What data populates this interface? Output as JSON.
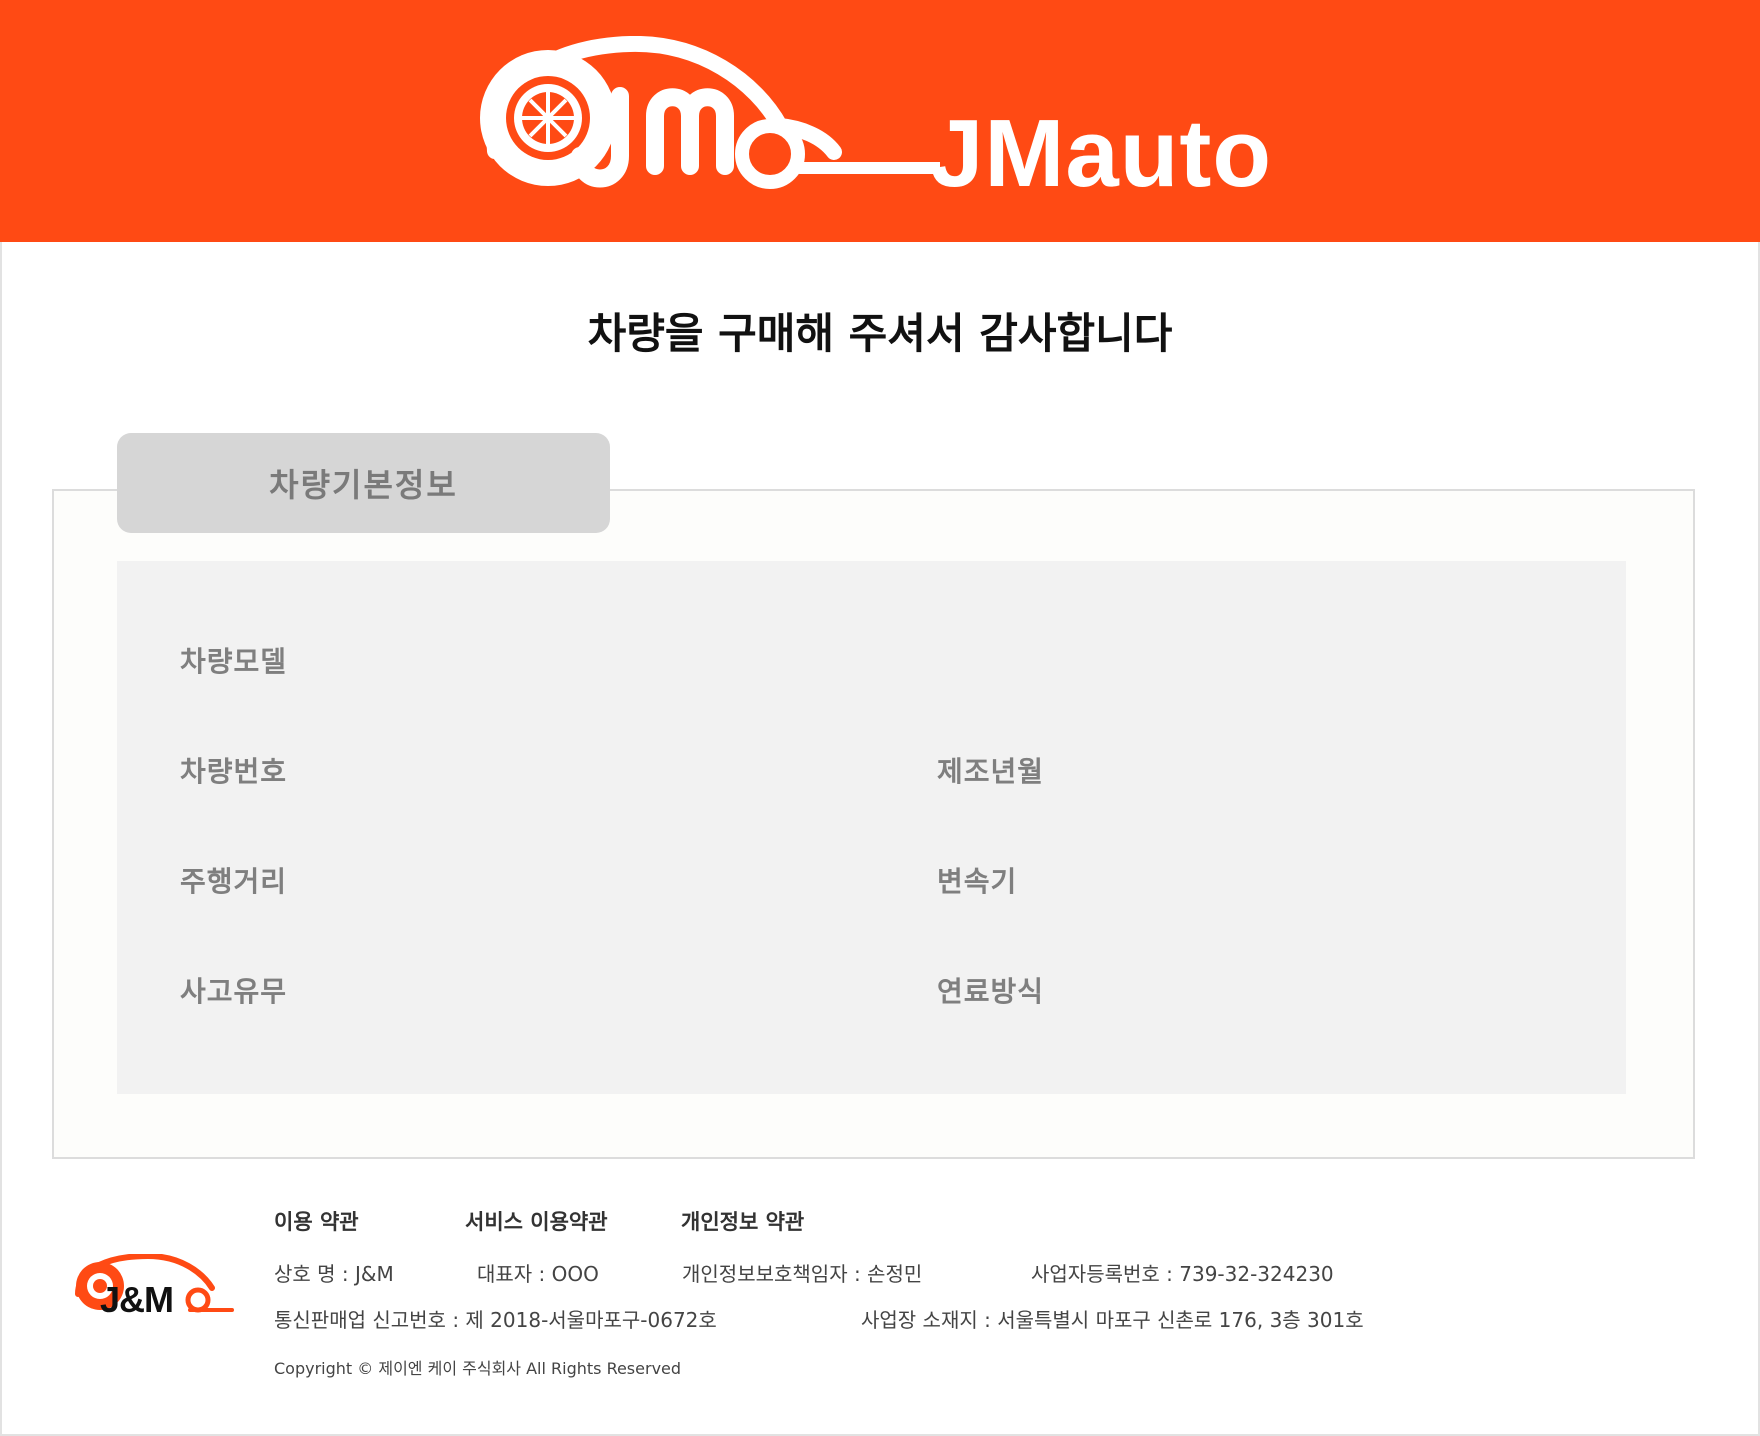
{
  "brand": {
    "name": "JMauto",
    "color": "#ff4a14",
    "footer_logo_text": "J&M"
  },
  "page": {
    "title": "차량을 구매해 주셔서 감사합니다"
  },
  "section": {
    "tab_label": "차량기본정보",
    "fields": {
      "model": "차량모델",
      "number": "차량번호",
      "manufacture_date": "제조년월",
      "mileage": "주행거리",
      "transmission": "변속기",
      "accident": "사고유무",
      "fuel": "연료방식"
    }
  },
  "footer": {
    "links": [
      "이용 약관",
      "서비스 이용약관",
      "개인정보 약관"
    ],
    "company_name": "상호 명 : J&M",
    "ceo": "대표자 : OOO",
    "privacy_officer": "개인정보보호책임자 : 손정민",
    "business_number": "사업자등록번호 : 739-32-324230",
    "mail_order_number": "통신판매업 신고번호 : 제 2018-서울마포구-0672호",
    "address": "사업장 소재지 : 서울특별시 마포구 신촌로 176, 3층 301호",
    "copyright": "Copyright © 제이엔 케이 주식회사 All Rights Reserved"
  }
}
